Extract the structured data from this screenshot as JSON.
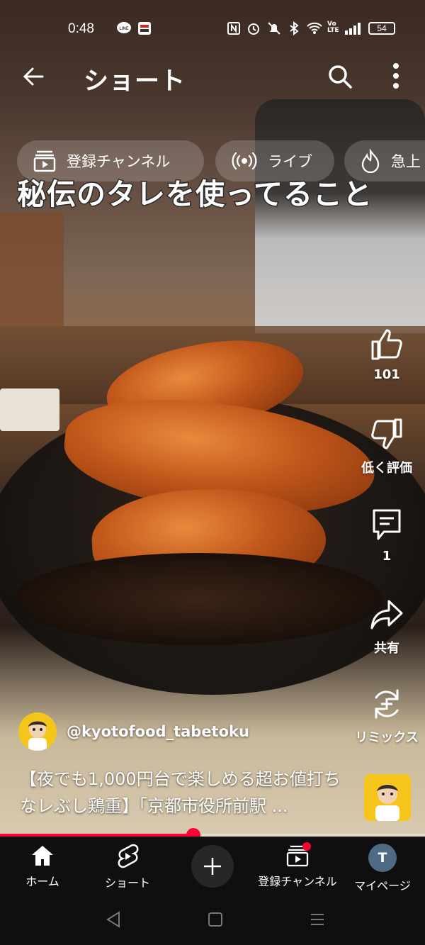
{
  "status_bar": {
    "time": "0:48",
    "battery": "54",
    "icons": [
      "line-app-icon",
      "app-notification-icon",
      "nfc-icon",
      "alarm-icon",
      "mute-icon",
      "bluetooth-icon",
      "wifi-icon",
      "volte-icon",
      "signal-icon",
      "battery-icon"
    ]
  },
  "top_bar": {
    "title": "ショート",
    "icons": [
      "back-arrow-icon",
      "search-icon",
      "more-vert-icon"
    ]
  },
  "chips": [
    {
      "label": "登録チャンネル",
      "icon": "subscriptions-icon"
    },
    {
      "label": "ライブ",
      "icon": "live-icon"
    },
    {
      "label": "急上",
      "icon": "trending-icon"
    }
  ],
  "video": {
    "caption_overlay": "秘伝のタレを使ってること",
    "channel": "@kyotofood_tabetoku",
    "title": "【夜でも1,000円台で楽しめる超お値打ちなレぶし鶏重】「京都市役所前駅 ...",
    "progress": 0.455
  },
  "actions": {
    "like_count": "101",
    "dislike_label": "低く評価",
    "comment_count": "1",
    "share_label": "共有",
    "remix_label": "リミックス"
  },
  "bottom_nav": {
    "home": "ホーム",
    "shorts": "ショート",
    "subscriptions": "登録チャンネル",
    "me": "マイページ",
    "me_initial": "T"
  },
  "colors": {
    "accent_red": "#ff0033",
    "nav_background": "#0f0f0f",
    "avatar_yellow": "#f6c51c"
  }
}
